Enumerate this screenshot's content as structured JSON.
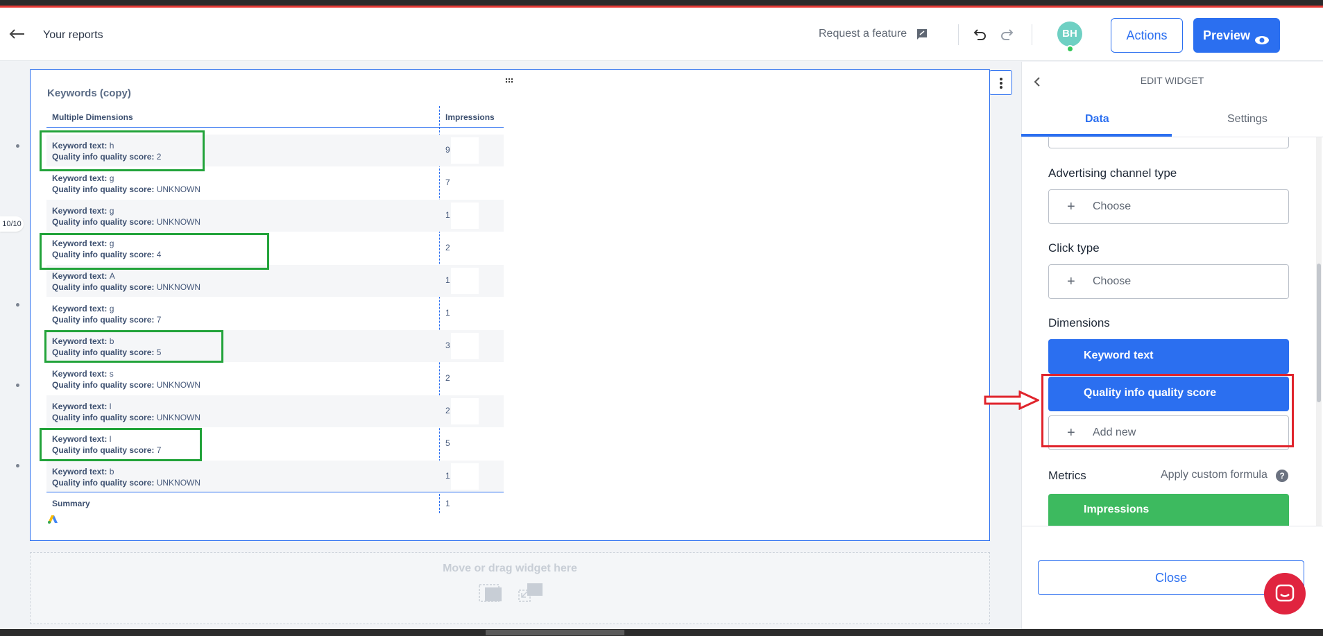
{
  "header": {
    "back_label": "Your reports",
    "request_feature": "Request a feature",
    "avatar_initials": "BH",
    "actions_label": "Actions",
    "preview_label": "Preview"
  },
  "page_indicator": "10/10",
  "widget": {
    "title": "Keywords (copy)",
    "columns": {
      "dimensions": "Multiple Dimensions",
      "impressions": "Impressions"
    },
    "keyword_label": "Keyword text:",
    "quality_label": "Quality info quality score:",
    "rows": [
      {
        "keyword": "h",
        "quality": "2",
        "impressions": "9"
      },
      {
        "keyword": "g",
        "quality": "UNKNOWN",
        "impressions": "7"
      },
      {
        "keyword": "g",
        "quality": "UNKNOWN",
        "impressions": "1"
      },
      {
        "keyword": "g",
        "quality": "4",
        "impressions": "2"
      },
      {
        "keyword": "A",
        "quality": "UNKNOWN",
        "impressions": "1"
      },
      {
        "keyword": "g",
        "quality": "7",
        "impressions": "1"
      },
      {
        "keyword": "b",
        "quality": "5",
        "impressions": "3"
      },
      {
        "keyword": "s",
        "quality": "UNKNOWN",
        "impressions": "2"
      },
      {
        "keyword": "l",
        "quality": "UNKNOWN",
        "impressions": "2"
      },
      {
        "keyword": "l",
        "quality": "7",
        "impressions": "5"
      },
      {
        "keyword": "b",
        "quality": "UNKNOWN",
        "impressions": "1"
      }
    ],
    "summary_label": "Summary",
    "summary_value": "1"
  },
  "dropzone": {
    "label": "Move or drag widget here"
  },
  "panel": {
    "title": "EDIT WIDGET",
    "tabs": {
      "data": "Data",
      "settings": "Settings"
    },
    "advertising_channel_label": "Advertising channel type",
    "click_type_label": "Click type",
    "choose_label": "Choose",
    "dimensions_label": "Dimensions",
    "dimensions": [
      "Keyword text",
      "Quality info quality score"
    ],
    "add_new_label": "Add new",
    "metrics_label": "Metrics",
    "custom_formula_label": "Apply custom formula",
    "metrics": [
      "Impressions"
    ],
    "close_label": "Close"
  },
  "colors": {
    "primary": "#2b6ff0",
    "metric_green": "#3dba5f",
    "highlight_green": "#22a33a",
    "annotation_red": "#e0242c"
  }
}
